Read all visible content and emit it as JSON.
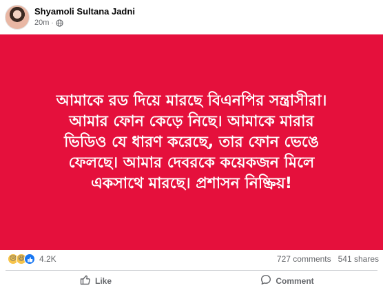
{
  "post": {
    "author": "Shyamoli Sultana Jadni",
    "time": "20m",
    "separator": "·",
    "banner_color": "#e5103c",
    "banner_lines": [
      "আমাকে রড দিয়ে মারছে বিএনপির সন্ত্রাসীরা।",
      "আমার ফোন কেড়ে নিছে। আমাকে মারার",
      "ভিডিও যে ধারণ করেছে, তার ফোন ভেঙে",
      "ফেলছে। আমার দেবরকে কয়েকজন মিলে",
      "একসাথে মারছে। প্রশাসন নিষ্ক্রিয়!"
    ]
  },
  "stats": {
    "reaction_icons": [
      "sad-reaction-icon",
      "haha-reaction-icon",
      "like-reaction-icon"
    ],
    "reaction_count": "4.2K",
    "comments": "727 comments",
    "shares": "541 shares"
  },
  "actions": {
    "like": "Like",
    "comment": "Comment"
  }
}
